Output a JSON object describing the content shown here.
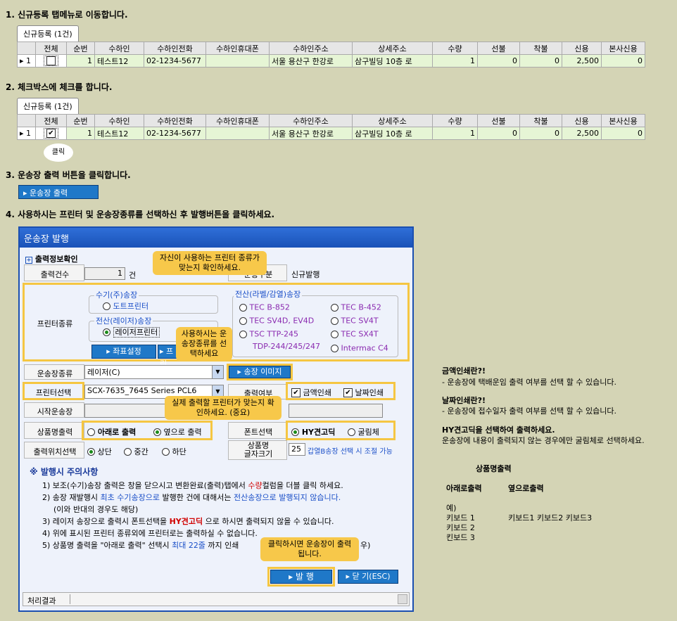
{
  "steps": {
    "s1": "1. 신규등록 탭메뉴로 이동합니다.",
    "s2": "2. 체크박스에 체크를 합니다.",
    "s3": "3. 운송장 출력 버튼을 클릭합니다.",
    "s4": "4. 사용하시는 프린터 및 운송장종류를 선택하신 후 발행버튼을 클릭하세요."
  },
  "grid": {
    "tab_label": "신규등록 (1건)",
    "headers": [
      "",
      "전체",
      "순번",
      "수하인",
      "수하인전화",
      "수하인휴대폰",
      "수하인주소",
      "상세주소",
      "수량",
      "선불",
      "착불",
      "신용",
      "본사신용"
    ],
    "row": {
      "arrow": "▸ 1",
      "seq": "1",
      "name": "테스트12",
      "phone": "02-1234-5677",
      "mobile": "",
      "addr": "서울 용산구 한강로",
      "detail": "삼구빌딩 10층 로",
      "qty": "1",
      "prepaid": "0",
      "cod": "0",
      "credit": "2,500",
      "hq": "0"
    }
  },
  "click_bubble": "클릭",
  "print_button": "운송장 출력",
  "dialog": {
    "title": "운송장 발행",
    "section": "출력정보확인",
    "count_label": "출력건수",
    "count_value": "1",
    "count_unit": "건",
    "type_label": "운송구분",
    "type_value": "신규발행",
    "printer_type_label": "프린터종류",
    "manual_group": "수기(주)송장",
    "dot_printer": "도트프린터",
    "laser_group": "전산(레이저)송장",
    "laser_printer": "레이저프린터",
    "coord_btn": "좌표설정",
    "printer_btn": "프린",
    "label_group": "전산(라벨/감열)송장",
    "label_printers": [
      "TEC B-852",
      "TEC B-452",
      "TEC SV4D, EV4D",
      "TEC SV4T",
      "TSC TTP-245",
      "TEC SX4T",
      "TDP-244/245/247",
      "Intermac C4"
    ],
    "waybill_type_label": "운송장종류",
    "waybill_type_value": "레이저(C)",
    "waybill_image_btn": "송장 이미지",
    "printer_select_label": "프린터선택",
    "printer_select_value": "SCX-7635_7645 Series PCL6",
    "print_yn_label": "출력여부",
    "amount_print": "금액인쇄",
    "date_print": "날짜인쇄",
    "start_label": "시작운송장",
    "product_label": "상품명출력",
    "product_below": "아래로 출력",
    "product_side": "옆으로 출력",
    "font_label": "폰트선택",
    "font_hy": "HY견고딕",
    "font_gulim": "굴림체",
    "pos_label": "출력위치선택",
    "pos_top": "상단",
    "pos_mid": "중간",
    "pos_bot": "하단",
    "size_label_1": "상품명",
    "size_label_2": "글자크기",
    "size_value": "25",
    "size_note": "갑열B송장 선택 시 조절 가능",
    "notes_title": "※ 발행시 주의사항",
    "note1_a": "1) 보조(수기)송장 출력은 창을 닫으시고 변환완료(출력)탭에서 ",
    "note1_b": "수량",
    "note1_c": "컬럼을 더블 클릭 하세요.",
    "note2_a": "2) 송장 재발행시 ",
    "note2_b": "최초 수기송장으로",
    "note2_c": " 발행한 건에 대해서는 ",
    "note2_d": "전산송장으로 발행되지 않습니다.",
    "note2_e": "(이와 반대의 경우도 해당)",
    "note3_a": "3) 레이저 송장으로 출력시 폰트선택을 ",
    "note3_b": "HY견고딕",
    "note3_c": " 으로 하시면 출력되지 않을 수 있습니다.",
    "note4": "4) 위에 표시된 프린터 종류외에 프린터로는 출력하실 수 없습니다.",
    "note5_a": "5) 상품명 출력을 \"아래로 출력\" 선택시 ",
    "note5_b": "최대 22줄",
    "note5_c": " 까지 인쇄",
    "note5_d": "우)",
    "issue_btn": "발  행",
    "close_btn": "닫 기(ESC)",
    "result_label": "처리결과"
  },
  "callouts": {
    "c1": "자신이 사용하는 프린터 종류가 맞는지 확인하세요.",
    "c2": "사용하시는 운송장종류를 선택하세요",
    "c3": "실제 출력할 프린터가 맞는지 확인하세요. (중요)",
    "c4": "클릭하시면 운송장이 출력됩니다."
  },
  "side": {
    "amount_title": "금액인쇄란?!",
    "amount_desc": "- 운송장에 택배운임 출력 여부를 선택 할 수 있습니다.",
    "date_title": "날짜인쇄란?!",
    "date_desc": "- 운송장에 접수일자 출력 여부를 선택 할 수 있습니다.",
    "hy_title": "HY견고딕을 선택하여 출력하세요.",
    "hy_desc": "운송장에 내용이 출력되지 않는 경우에만 굴림체로 선택하세요.",
    "product_title": "상품명출력",
    "col_below": "아래로출력",
    "col_side": "옆으로출력",
    "example": "예)",
    "kb1": "키보드 1",
    "kb2": "키보드 2",
    "kb3": "킨보드 3",
    "kb_line": "키보드1 키보드2 키보드3"
  }
}
